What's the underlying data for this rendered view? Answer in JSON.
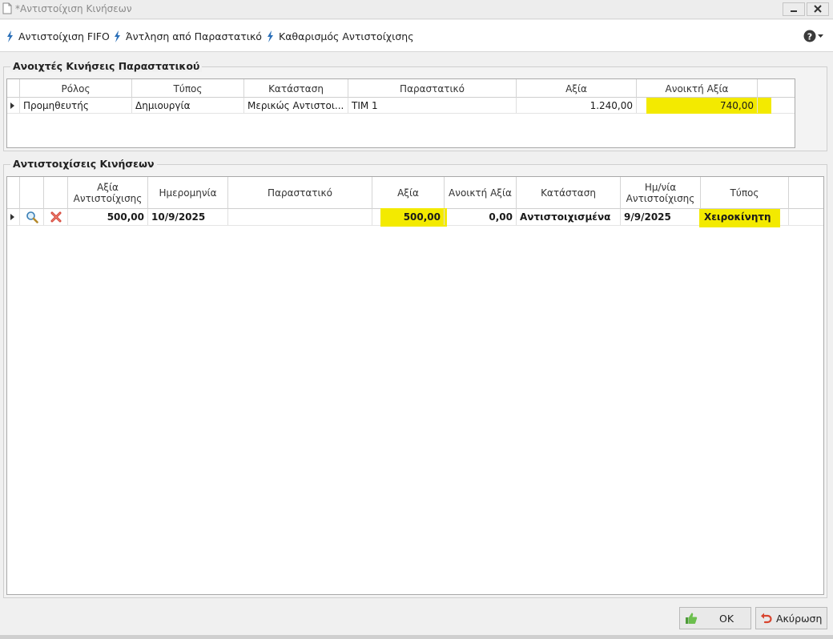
{
  "window": {
    "title": "*Αντιστοίχιση Κινήσεων"
  },
  "toolbar": {
    "fifo_label": "Αντιστοίχιση FIFO",
    "fetch_label": "Άντληση από Παραστατικό",
    "clear_label": "Καθαρισμός Αντιστοίχισης"
  },
  "open_movements": {
    "title": "Ανοιχτές Κινήσεις Παραστατικού",
    "columns": [
      "Ρόλος",
      "Τύπος",
      "Κατάσταση",
      "Παραστατικό",
      "Αξία",
      "Ανοικτή Αξία"
    ],
    "rows": [
      {
        "role": "Προμηθευτής",
        "type": "Δημιουργία",
        "status": "Μερικώς Αντιστοι...",
        "document": "ΤΙΜ 1",
        "value": "1.240,00",
        "open_value": "740,00"
      }
    ]
  },
  "matches": {
    "title": "Αντιστοιχίσεις Κινήσεων",
    "columns": [
      "Αξία Αντιστοίχισης",
      "Ημερομηνία",
      "Παραστατικό",
      "Αξία",
      "Ανοικτή Αξία",
      "Κατάσταση",
      "Ημ/νία Αντιστοίχισης",
      "Τύπος"
    ],
    "rows": [
      {
        "match_value": "500,00",
        "date": "10/9/2025",
        "document": "",
        "value": "500,00",
        "open_value": "0,00",
        "status": "Αντιστοιχισμένα",
        "match_date": "9/9/2025",
        "type": "Χειροκίνητη"
      }
    ]
  },
  "footer": {
    "ok_label": "OK",
    "cancel_label": "Ακύρωση"
  },
  "colors": {
    "highlight": "#f3ea00",
    "accent": "#2a6fb8"
  },
  "icons": [
    "document-icon",
    "minimize-icon",
    "close-icon",
    "lightning-icon",
    "help-icon",
    "magnifier-icon",
    "delete-x-icon",
    "row-indicator-icon",
    "thumbs-up-icon",
    "undo-icon"
  ]
}
